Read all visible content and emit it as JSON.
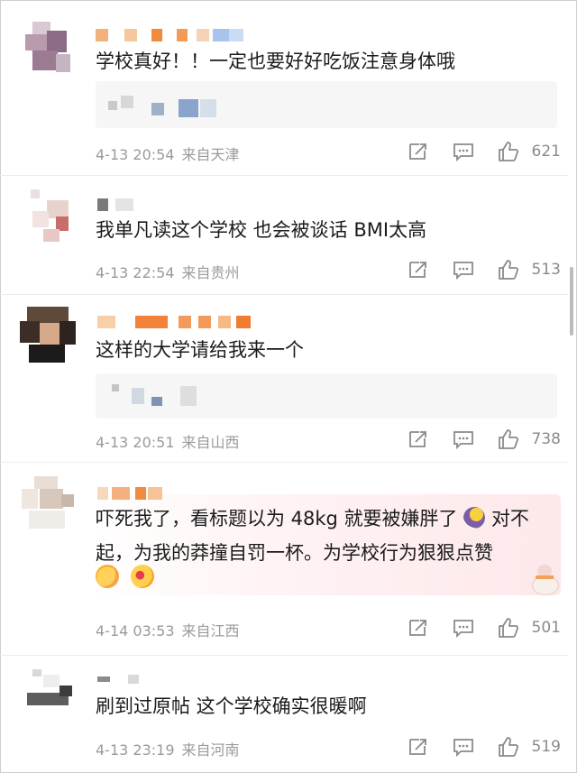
{
  "comments": [
    {
      "text": "学校真好！！一定也要好好吃饭注意身体哦",
      "date": "4-13 20:54",
      "location": "来自天津",
      "likes": "621"
    },
    {
      "text": "我单凡读这个学校  也会被谈话  BMI太高",
      "date": "4-13 22:54",
      "location": "来自贵州",
      "likes": "513"
    },
    {
      "text": "这样的大学请给我来一个",
      "date": "4-13 20:51",
      "location": "来自山西",
      "likes": "738"
    },
    {
      "text_line1": "吓死我了，看标题以为 48kg 就要被嫌胖了",
      "text_line1_tail": "对不",
      "text_line2": "起，为我的莽撞自罚一杯。为学校行为狠狠点赞",
      "date": "4-14 03:53",
      "location": "来自江西",
      "likes": "501"
    },
    {
      "text": "刷到过原帖 这个学校确实很暖啊",
      "date": "4-13 23:19",
      "location": "来自河南",
      "likes": "519"
    }
  ],
  "icons": {
    "share": "share-icon",
    "comment": "comment-icon",
    "like": "thumbs-up-icon"
  },
  "colors": {
    "meta": "#9a9a9a",
    "text": "#1b1b1b",
    "divider": "#ececec"
  }
}
